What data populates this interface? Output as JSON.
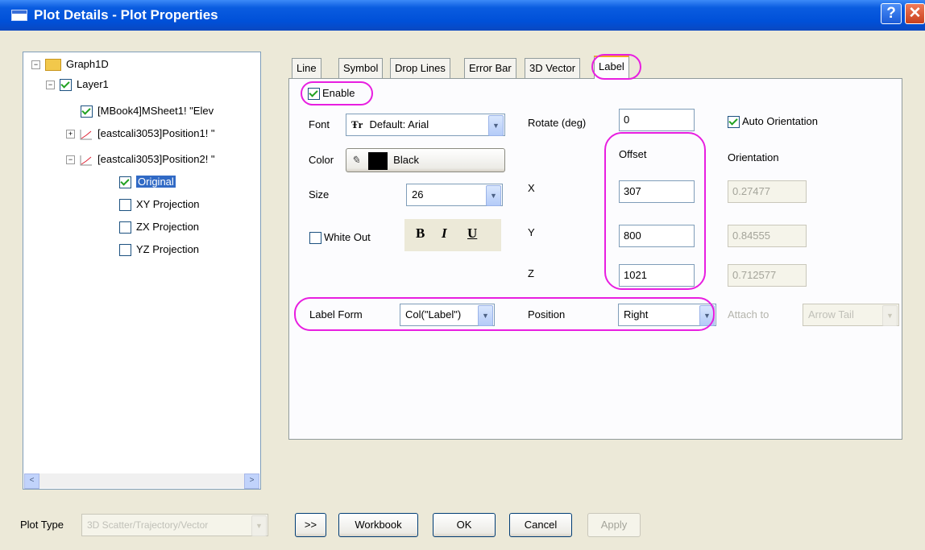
{
  "window": {
    "title": "Plot Details - Plot Properties",
    "help": "?",
    "close": "✕"
  },
  "tree": {
    "graph": "Graph1D",
    "layer": "Layer1",
    "items": [
      "[MBook4]MSheet1! \"Elev",
      "[eastcali3053]Position1! \"",
      "[eastcali3053]Position2! \""
    ],
    "subitems": [
      "Original",
      "XY Projection",
      "ZX Projection",
      "YZ Projection"
    ],
    "scroll_left": "<",
    "scroll_right": ">"
  },
  "tabs": [
    "Line",
    "Symbol",
    "Drop Lines",
    "Error Bar",
    "3D Vector",
    "Label"
  ],
  "label_tab": {
    "enable": "Enable",
    "font_label": "Font",
    "font_value": "Default: Arial",
    "color_label": "Color",
    "color_value": "Black",
    "size_label": "Size",
    "size_value": "26",
    "white_out": "White Out",
    "bold": "B",
    "italic": "I",
    "underline": "U",
    "rotate_label": "Rotate (deg)",
    "rotate_value": "0",
    "auto_orientation": "Auto Orientation",
    "offset_header": "Offset",
    "orientation_header": "Orientation",
    "x_label": "X",
    "y_label": "Y",
    "z_label": "Z",
    "offset_x": "307",
    "offset_y": "800",
    "offset_z": "1021",
    "orient_x": "0.27477",
    "orient_y": "0.84555",
    "orient_z": "0.712577",
    "label_form_label": "Label Form",
    "label_form_value": "Col(\"Label\")",
    "position_label": "Position",
    "position_value": "Right",
    "attach_label": "Attach to",
    "attach_value": "Arrow Tail"
  },
  "bottom": {
    "plot_type_label": "Plot Type",
    "plot_type_value": "3D Scatter/Trajectory/Vector",
    "more": ">>",
    "workbook": "Workbook",
    "ok": "OK",
    "cancel": "Cancel",
    "apply": "Apply"
  },
  "colors": {
    "highlight": "#e81ee0",
    "title_blue": "#0050d8",
    "selection": "#316ac5"
  }
}
